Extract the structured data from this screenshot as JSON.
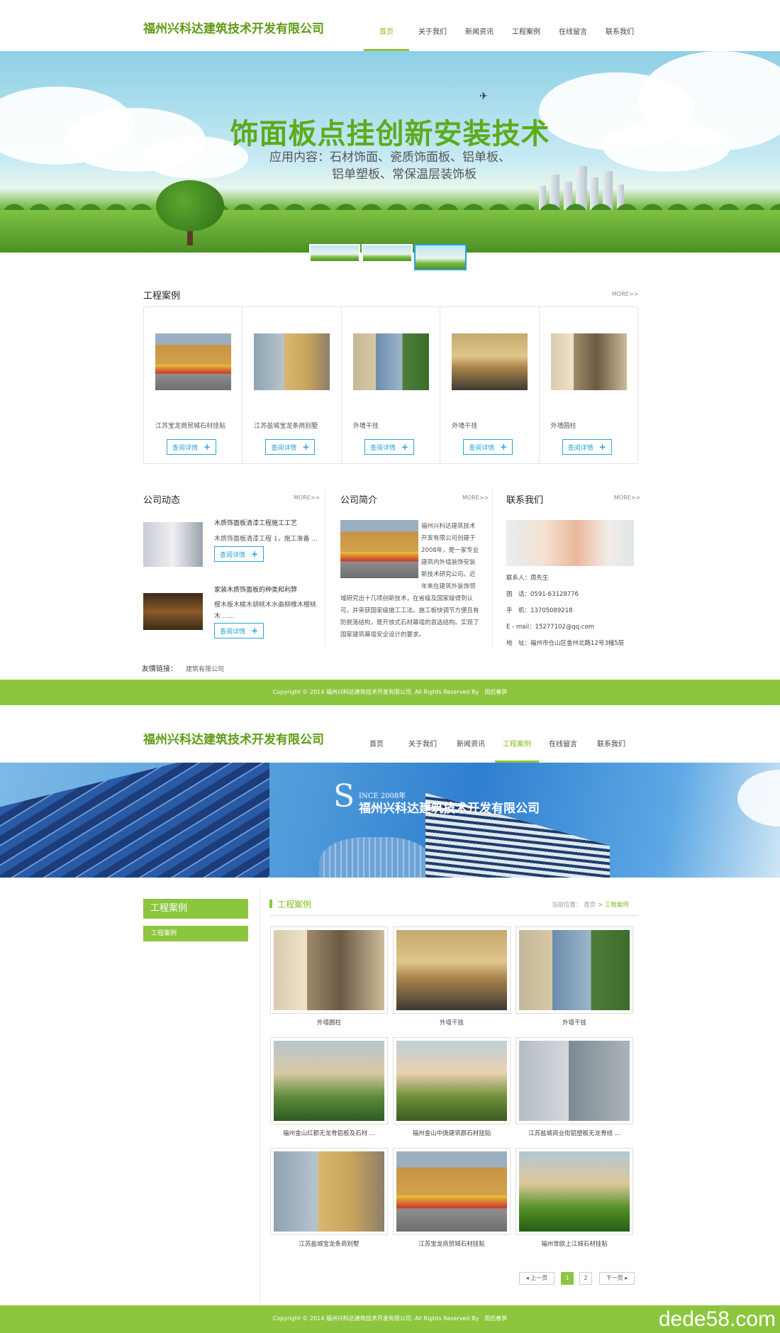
{
  "page1": {
    "logo": "福州兴科达建筑技术开发有限公司",
    "nav": [
      "首页",
      "关于我们",
      "新闻资讯",
      "工程案例",
      "在线留言",
      "联系我们"
    ],
    "banner": {
      "title": "饰面板点挂创新安装技术",
      "subtitle_line1": "应用内容：石材饰面、瓷质饰面板、铝单板、",
      "subtitle_line2": "铝单塑板、常保温层装饰板"
    },
    "cases": {
      "title": "工程案例",
      "more": "MORE>>",
      "items": [
        {
          "caption": "江苏宝龙商贸城石材挂贴",
          "button": "查阅详情"
        },
        {
          "caption": "江苏盐城宝龙条商别墅",
          "button": "查阅详情"
        },
        {
          "caption": "外墙干挂",
          "button": "查阅详情"
        },
        {
          "caption": "外墙干挂",
          "button": "查阅详情"
        },
        {
          "caption": "外墙圆柱",
          "button": "查阅详情"
        }
      ]
    },
    "news": {
      "title": "公司动态",
      "more": "MORE>>",
      "items": [
        {
          "title": "木质饰面板清漆工程施工工艺",
          "desc": "木质饰面板清漆工程 1，施工准备 ...",
          "button": "查阅详情"
        },
        {
          "title": "家装木质饰面板的种类和利弊",
          "desc": "樱木板木榆木胡桃木水曲柳橡木樱桃木 ......",
          "button": "查阅详情"
        }
      ]
    },
    "intro": {
      "title": "公司简介",
      "more": "MORE>>",
      "text": "福州兴科达建筑技术开发有限公司创建于2008年，是一家专业建筑内外墙装饰安装新技术研究公司。近年来在建筑外装饰领域研究出十几项创新技术，在省级及国家级得到认可，并荣获国家级施工工法。施工板快调节方便且有防脱落结构，是开放式石材幕墙的首选结构。实现了国家建筑幕墙安全设计的要求。"
    },
    "contact": {
      "title": "联系我们",
      "more": "MORE>>",
      "lines": [
        "联系人：周先生",
        "固　话：0591-63128776",
        "手　机：13705089218",
        "E - mail：15277102@qq.com",
        "地　址：福州市仓山区金州北路12号3幢5层"
      ]
    },
    "links": {
      "label": "友情链接：",
      "items": [
        "建筑有限公司"
      ]
    },
    "footer": "Copyright © 2014 福州兴科达建筑技术开发有限公司. All Rights Reserved By　雨后春笋"
  },
  "page2": {
    "logo": "福州兴科达建筑技术开发有限公司",
    "nav": [
      "首页",
      "关于我们",
      "新闻资讯",
      "工程案例",
      "在线留言",
      "联系我们"
    ],
    "banner": {
      "since": "INCE 2008年",
      "since_initial": "S",
      "company": "福州兴科达建筑技术开发有限公司"
    },
    "sidebar": {
      "title": "工程案例",
      "items": [
        "工程案例"
      ]
    },
    "section_title": "工程案例",
    "breadcrumb": {
      "label": "当前位置：",
      "home": "首页",
      "sep": ">",
      "current": "工程案例"
    },
    "grid": [
      {
        "caption": "外墙圆柱"
      },
      {
        "caption": "外墙干挂"
      },
      {
        "caption": "外墙干挂"
      },
      {
        "caption": "福州金山红郡无龙骨铝板及石材 ..."
      },
      {
        "caption": "福州金山中庚建筑群石材挂贴"
      },
      {
        "caption": "江苏盐城商业街铝塑板无龙骨结 ..."
      },
      {
        "caption": "江苏盐城宝龙条商别墅"
      },
      {
        "caption": "江苏宝龙商贸城石材挂贴"
      },
      {
        "caption": "福州世欧上江城石材挂贴"
      }
    ],
    "pager": {
      "prev": "上一页",
      "pages": [
        "1",
        "2"
      ],
      "next": "下一页",
      "current": "1"
    },
    "footer": "Copyright © 2014 福州兴科达建筑技术开发有限公司. All Rights Reserved By　雨后春笋"
  },
  "watermark": "dede58.com",
  "colors": {
    "accent": "#8cc63f",
    "logo": "#5f9c16",
    "link": "#28a4d9"
  }
}
